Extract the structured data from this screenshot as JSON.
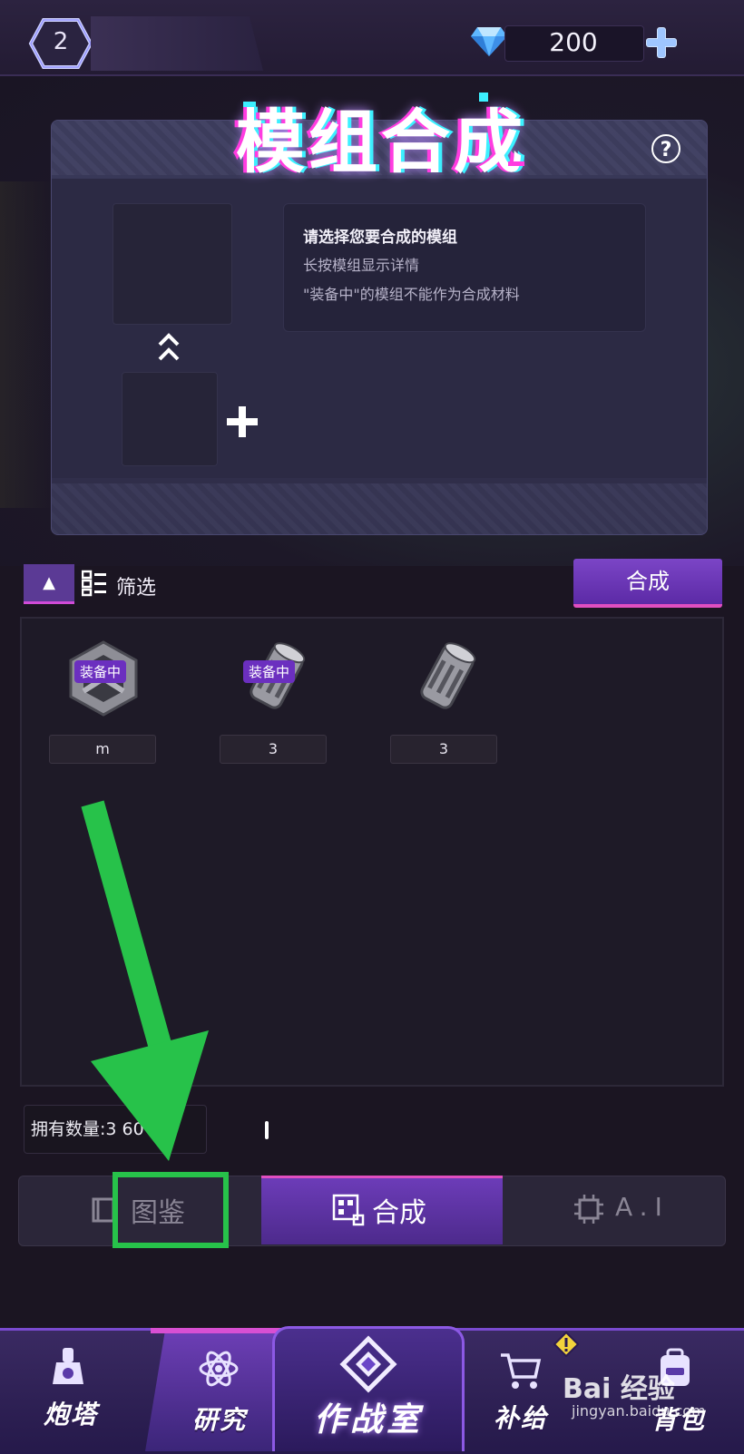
{
  "header": {
    "level": "2",
    "diamond_count": "200"
  },
  "panel": {
    "title": "模组合成",
    "help": "?",
    "info_lines": [
      "请选择您要合成的模组",
      "长按模组显示详情",
      "\"装备中\"的模组不能作为合成材料"
    ]
  },
  "filter": {
    "sort_glyph": "▲",
    "label": "筛选",
    "compose_button": "合成"
  },
  "modules": [
    {
      "badge": "装备中",
      "level": "m"
    },
    {
      "badge": "装备中",
      "level": "3"
    },
    {
      "badge": "",
      "level": "3"
    }
  ],
  "count": {
    "text": "拥有数量:3    60"
  },
  "subtabs": {
    "codex": "图鉴",
    "compose": "合成",
    "ai": "A.I"
  },
  "nav": {
    "turret": "炮塔",
    "research": "研究",
    "war_room": "作战室",
    "supply": "补给",
    "backpack": "背包"
  },
  "watermark": {
    "brand": "Bai 经验",
    "url": "jingyan.baidu.com"
  },
  "colors": {
    "accent_purple": "#6c3cb8",
    "accent_pink": "#e04fc0",
    "annotation_green": "#27c24a"
  }
}
